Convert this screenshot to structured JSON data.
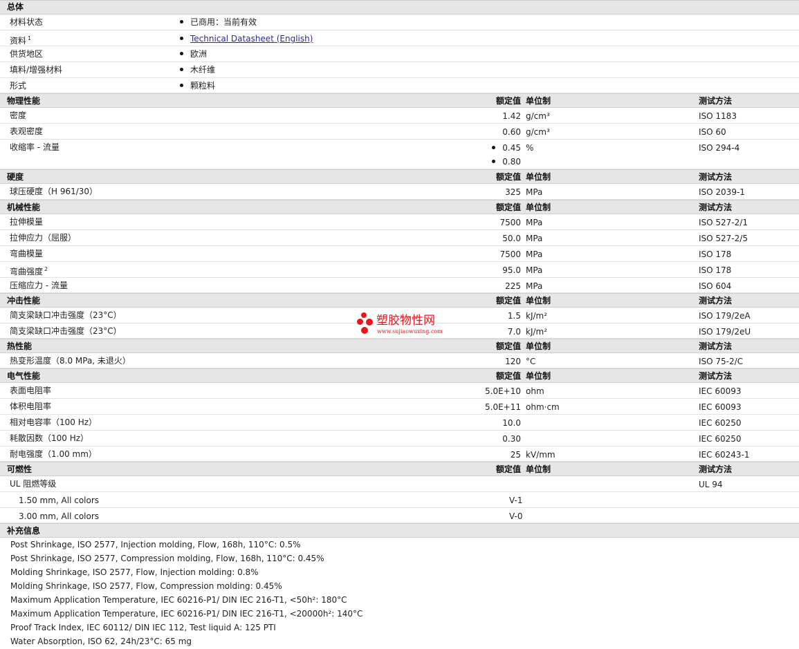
{
  "general": {
    "title": "总体",
    "rows": [
      {
        "name": "材料状态",
        "value": "已商用：当前有效"
      },
      {
        "name": "资料",
        "sup": "1",
        "value": "Technical Datasheet (English)"
      },
      {
        "name": "供货地区",
        "value": "欧洲"
      },
      {
        "name": "填料/增强材料",
        "value": "木纤维"
      },
      {
        "name": "形式",
        "value": "颗粒料"
      }
    ]
  },
  "columns": {
    "value": "额定值",
    "unit": "单位制",
    "test": "测试方法"
  },
  "physical": {
    "title": "物理性能",
    "rows": [
      {
        "name": "密度",
        "value": "1.42",
        "unit": "g/cm³",
        "test": "ISO 1183"
      },
      {
        "name": "表观密度",
        "value": "0.60",
        "unit": "g/cm³",
        "test": "ISO 60"
      },
      {
        "name": "收缩率 - 流量",
        "value": "0.45",
        "value2": "0.80",
        "unit": "%",
        "test": "ISO 294-4"
      }
    ]
  },
  "hardness": {
    "title": "硬度",
    "rows": [
      {
        "name": "球压硬度（H 961/30）",
        "value": "325",
        "unit": "MPa",
        "test": "ISO 2039-1"
      }
    ]
  },
  "mechanical": {
    "title": "机械性能",
    "rows": [
      {
        "name": "拉伸模量",
        "value": "7500",
        "unit": "MPa",
        "test": "ISO 527-2/1"
      },
      {
        "name": "拉伸应力（屈服）",
        "value": "50.0",
        "unit": "MPa",
        "test": "ISO 527-2/5"
      },
      {
        "name": "弯曲模量",
        "value": "7500",
        "unit": "MPa",
        "test": "ISO 178"
      },
      {
        "name": "弯曲强度",
        "sup": "2",
        "value": "95.0",
        "unit": "MPa",
        "test": "ISO 178"
      },
      {
        "name": "压缩应力 - 流量",
        "value": "225",
        "unit": "MPa",
        "test": "ISO 604"
      }
    ]
  },
  "impact": {
    "title": "冲击性能",
    "rows": [
      {
        "name": "简支梁缺口冲击强度（23°C）",
        "value": "1.5",
        "unit": "kJ/m²",
        "test": "ISO 179/2eA"
      },
      {
        "name": "简支梁缺口冲击强度（23°C）",
        "value": "7.0",
        "unit": "kJ/m²",
        "test": "ISO 179/2eU"
      }
    ]
  },
  "thermal": {
    "title": "热性能",
    "rows": [
      {
        "name": "热变形温度（8.0 MPa, 未退火）",
        "value": "120",
        "unit": "°C",
        "test": "ISO 75-2/C"
      }
    ]
  },
  "electrical": {
    "title": "电气性能",
    "rows": [
      {
        "name": "表面电阻率",
        "value": "5.0E+10",
        "unit": "ohm",
        "test": "IEC 60093"
      },
      {
        "name": "体积电阻率",
        "value": "5.0E+11",
        "unit": "ohm·cm",
        "test": "IEC 60093"
      },
      {
        "name": "相对电容率（100 Hz）",
        "value": "10.0",
        "unit": "",
        "test": "IEC 60250"
      },
      {
        "name": "耗散因数（100 Hz）",
        "value": "0.30",
        "unit": "",
        "test": "IEC 60250"
      },
      {
        "name": "耐电强度（1.00 mm）",
        "value": "25",
        "unit": "kV/mm",
        "test": "IEC 60243-1"
      }
    ]
  },
  "flammability": {
    "title": "可燃性",
    "ul_name": "UL 阻燃等级",
    "ul_test": "UL 94",
    "rows": [
      {
        "name": "1.50 mm, All colors",
        "value": "V-1"
      },
      {
        "name": "3.00 mm, All colors",
        "value": "V-0"
      }
    ]
  },
  "supplemental": {
    "title": "补充信息",
    "lines": [
      "Post Shrinkage, ISO 2577, Injection molding, Flow, 168h, 110°C: 0.5%",
      "Post Shrinkage, ISO 2577, Compression molding, Flow, 168h, 110°C: 0.45%",
      "Molding Shrinkage, ISO 2577, Flow, Injection molding: 0.8%",
      "Molding Shrinkage, ISO 2577, Flow, Compression molding: 0.45%",
      "Maximum Application Temperature, IEC 60216-P1/ DIN IEC 216-T1, <50h²: 180°C",
      "Maximum Application Temperature, IEC 60216-P1/ DIN IEC 216-T1, <20000h²: 140°C",
      "Proof Track Index, IEC 60112/ DIN IEC 112, Test liquid A: 125 PTI",
      "Water Absorption, ISO 62, 24h/23°C: 65 mg"
    ]
  },
  "watermark": {
    "name": "塑胶物性网",
    "url": "www.sujiaowuxing.com",
    "color": "#e8161c"
  }
}
